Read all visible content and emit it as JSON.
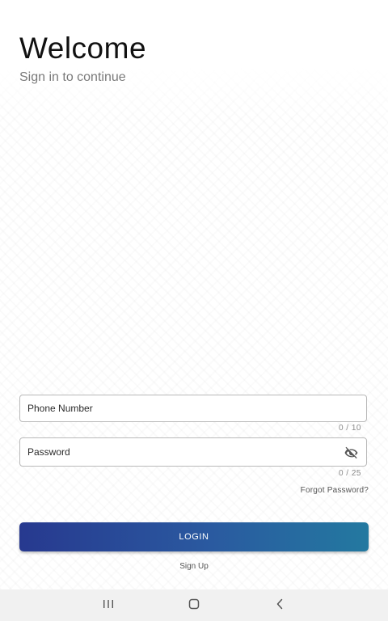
{
  "header": {
    "title": "Welcome",
    "subtitle": "Sign in to continue"
  },
  "form": {
    "phone": {
      "placeholder": "Phone Number",
      "value": "",
      "counter": "0 / 10"
    },
    "password": {
      "placeholder": "Password",
      "value": "",
      "counter": "0 / 25",
      "toggle_icon": "eye-off-icon"
    },
    "forgot_label": "Forgot Password?",
    "login_label": "LOGIN",
    "signup_label": "Sign Up"
  },
  "navbar": {
    "recents_icon": "recents-icon",
    "home_icon": "home-icon",
    "back_icon": "back-icon"
  },
  "colors": {
    "button_gradient_start": "#27398f",
    "button_gradient_end": "#2379a0",
    "navbar_bg": "#f1f1f1"
  }
}
